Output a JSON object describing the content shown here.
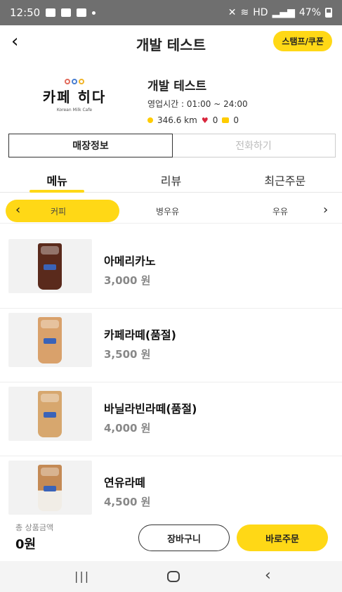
{
  "status": {
    "time": "12:50",
    "battery": "47%",
    "network": "HD"
  },
  "header": {
    "back_icon": "chevron-left-icon",
    "title": "개발 테스트",
    "stamp_coupon": "스탬프/쿠폰"
  },
  "store": {
    "logo_text": "카페 히다",
    "logo_sub": "Korean Milk Cafe",
    "name": "개발 테스트",
    "hours": "영업시간 : 01:00 ~ 24:00",
    "distance": "346.6 km",
    "likes": "0",
    "reviews": "0"
  },
  "info_tabs": [
    "매장정보",
    "전화하기"
  ],
  "menu_tabs": [
    "메뉴",
    "리뷰",
    "최근주문"
  ],
  "categories": [
    "커피",
    "병우유",
    "우유"
  ],
  "menu_items": [
    {
      "name": "아메리카노",
      "price": "3,000 원",
      "color": "#5a2a1c"
    },
    {
      "name": "카페라떼(품절)",
      "price": "3,500 원",
      "color": "#d9a16b"
    },
    {
      "name": "바닐라빈라떼(품절)",
      "price": "4,000 원",
      "color": "#d7a76e"
    },
    {
      "name": "연유라떼",
      "price": "4,500 원",
      "color": "#c48a55"
    }
  ],
  "footer": {
    "total_label": "총 상품금액",
    "total_value": "0원",
    "cart": "장바구니",
    "order": "바로주문"
  },
  "colors": {
    "accent": "#ffd816",
    "statusbar": "#6f6f6f"
  }
}
